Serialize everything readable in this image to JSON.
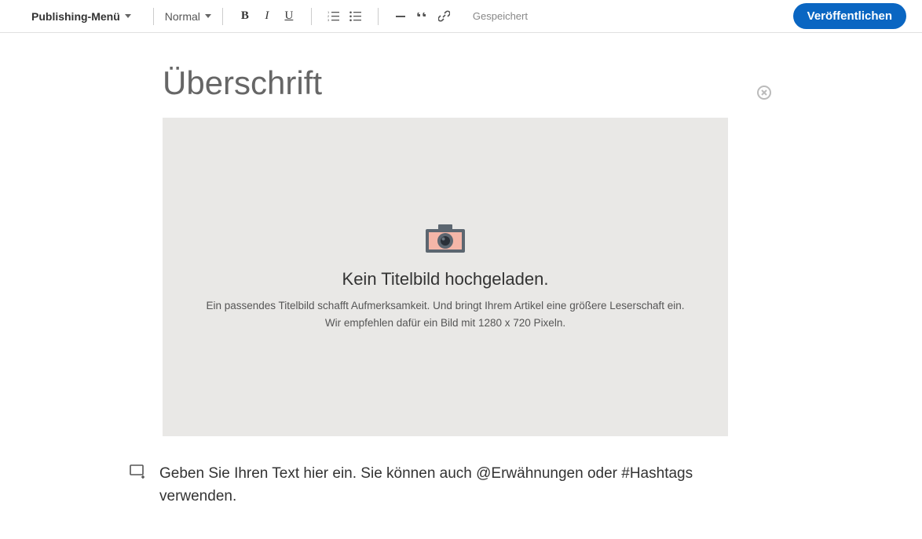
{
  "toolbar": {
    "publishing_menu": "Publishing-Menü",
    "style_select": "Normal",
    "bold": "B",
    "italic": "I",
    "underline": "U",
    "saved": "Gespeichert",
    "publish": "Veröffentlichen"
  },
  "editor": {
    "headline_placeholder": "Überschrift",
    "image_drop": {
      "title": "Kein Titelbild hochgeladen.",
      "line1": "Ein passendes Titelbild schafft Aufmerksamkeit. Und bringt Ihrem Artikel eine größere Leserschaft ein.",
      "line2": "Wir empfehlen dafür ein Bild mit 1280 x 720 Pixeln."
    },
    "body_placeholder": "Geben Sie Ihren Text hier ein. Sie können auch @Erwähnungen oder #Hashtags verwenden."
  }
}
